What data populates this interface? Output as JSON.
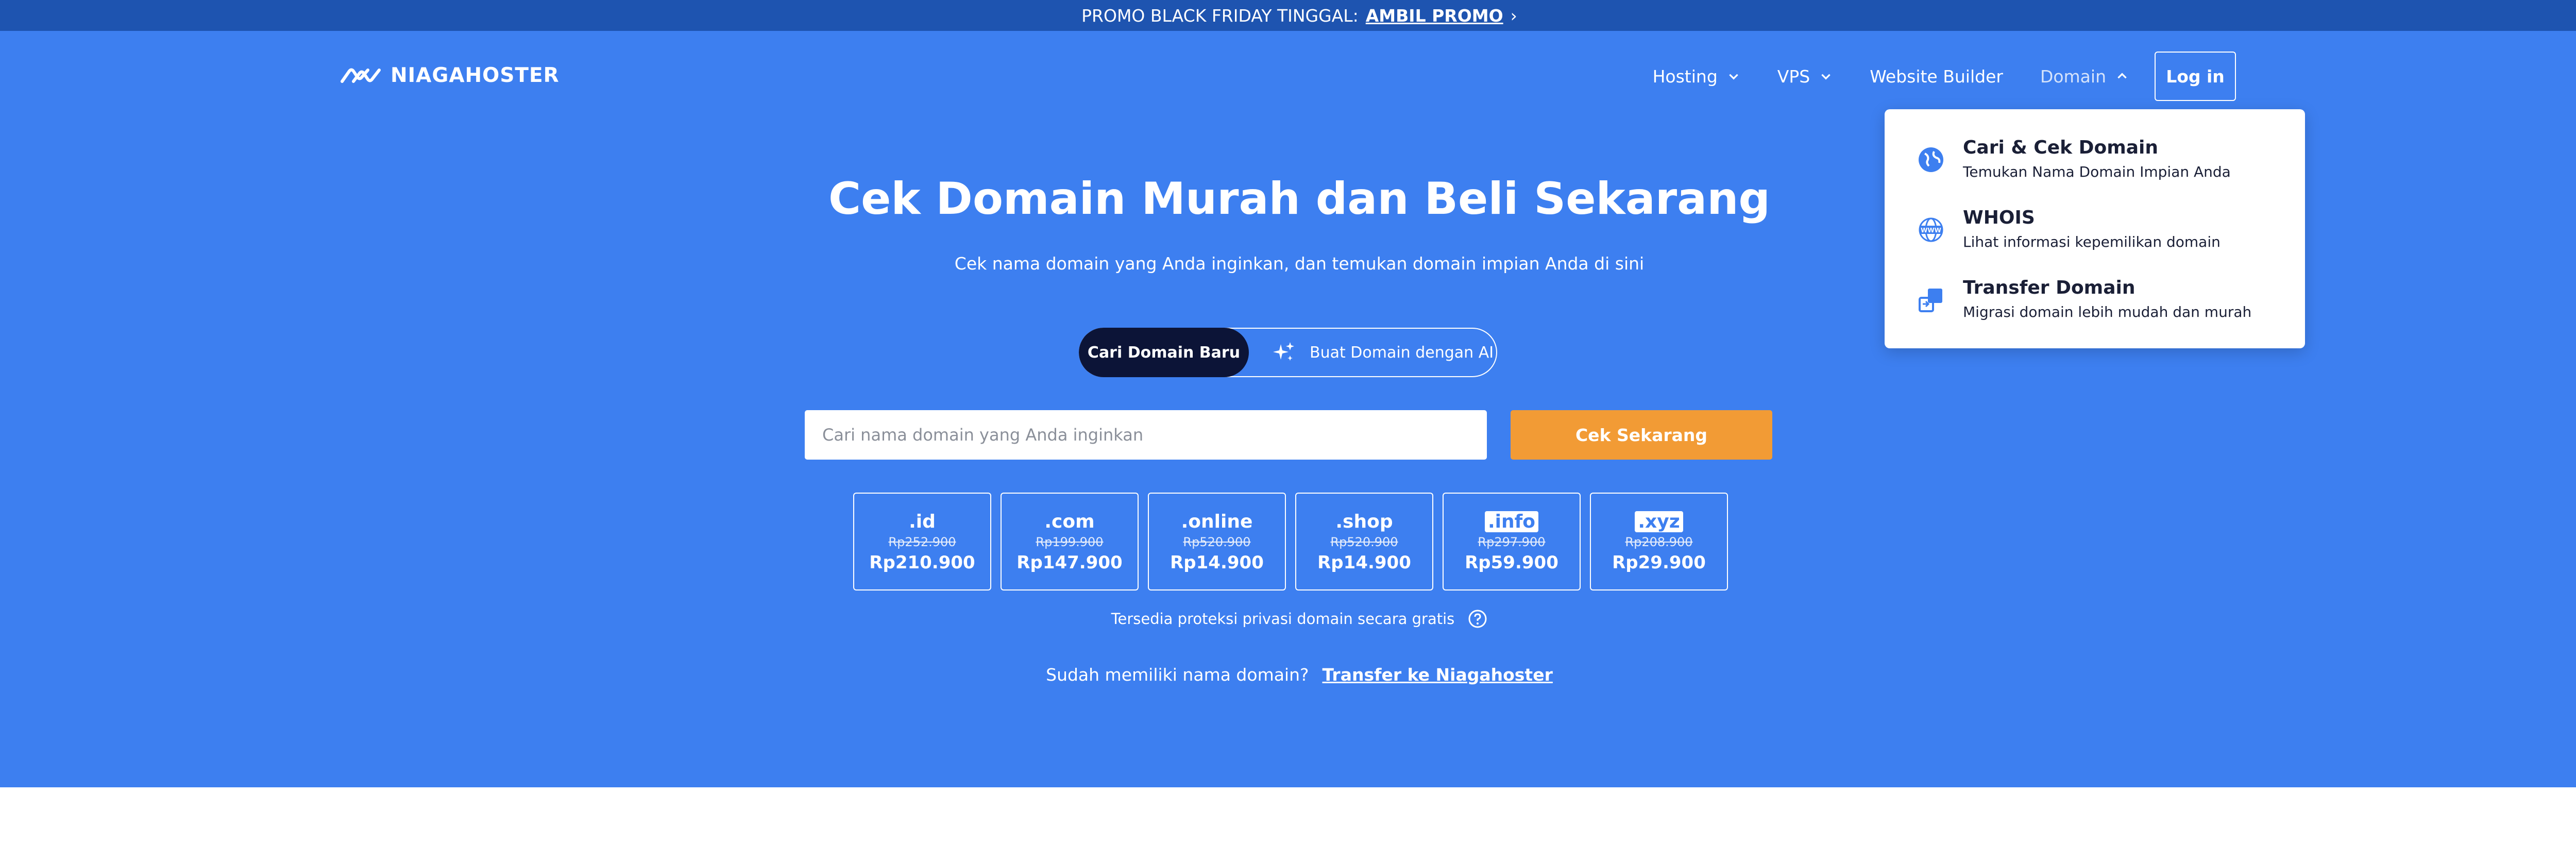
{
  "promo": {
    "text": "PROMO BLACK FRIDAY TINGGAL:",
    "link": "AMBIL PROMO",
    "arrow": "›"
  },
  "header": {
    "logo_text": "NIAGAHOSTER",
    "nav": [
      {
        "label": "Hosting",
        "icon": "chevron-down-icon"
      },
      {
        "label": "VPS",
        "icon": "chevron-down-icon"
      },
      {
        "label": "Website Builder"
      },
      {
        "label": "Domain",
        "icon": "chevron-up-icon"
      }
    ],
    "login": "Log in"
  },
  "dropdown": {
    "items": [
      {
        "title": "Cari & Cek Domain",
        "desc": "Temukan Nama Domain Impian Anda",
        "icon": "globe-icon"
      },
      {
        "title": "WHOIS",
        "desc": "Lihat informasi kepemilikan domain",
        "icon": "whois-globe-icon"
      },
      {
        "title": "Transfer Domain",
        "desc": "Migrasi domain lebih mudah dan murah",
        "icon": "transfer-icon"
      }
    ]
  },
  "hero": {
    "title": "Cek Domain Murah dan Beli Sekarang",
    "subtitle": "Cek nama domain yang Anda inginkan, dan temukan domain impian Anda di sini",
    "toggle_active": "Cari Domain Baru",
    "toggle_other": "Buat Domain dengan AI",
    "search_placeholder": "Cari nama domain yang Anda inginkan",
    "search_button": "Cek Sekarang",
    "tlds": [
      {
        "name": ".id",
        "old_price": "Rp252.900",
        "new_price": "Rp210.900"
      },
      {
        "name": ".com",
        "old_price": "Rp199.900",
        "new_price": "Rp147.900"
      },
      {
        "name": ".online",
        "old_price": "Rp520.900",
        "new_price": "Rp14.900"
      },
      {
        "name": ".shop",
        "old_price": "Rp520.900",
        "new_price": "Rp14.900"
      },
      {
        "name": ".info",
        "old_price": "Rp297.900",
        "new_price": "Rp59.900"
      },
      {
        "name": ".xyz",
        "old_price": "Rp208.900",
        "new_price": "Rp29.900"
      }
    ],
    "privacy_text": "Tersedia proteksi privasi domain secara gratis",
    "transfer_text": "Sudah memiliki nama domain?",
    "transfer_link": "Transfer ke Niagahoster"
  },
  "colors": {
    "hero_bg": "#3d7ff0",
    "promo_bg": "#1e54b0",
    "cta": "#f29b35",
    "toggle_active": "#0c1437"
  }
}
